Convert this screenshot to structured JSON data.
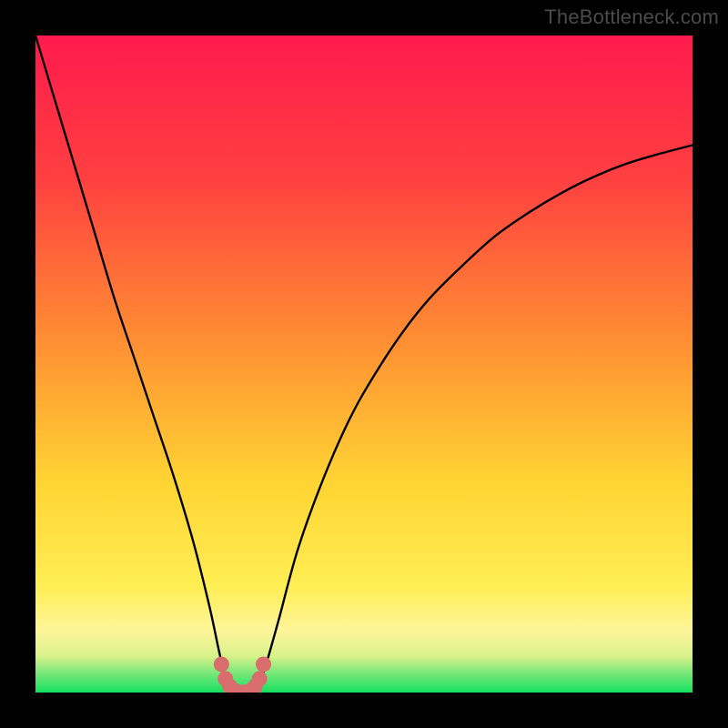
{
  "watermark": "TheBottleneck.com",
  "chart_data": {
    "type": "line",
    "title": "",
    "xlabel": "",
    "ylabel": "",
    "xlim": [
      0,
      100
    ],
    "ylim": [
      0,
      100
    ],
    "grid": false,
    "legend": false,
    "notes": "V-shaped bottleneck curve on a red→yellow→green vertical gradient background. Y represents bottleneck severity (0 = no bottleneck / green at bottom, 100 = severe / red at top). Minimum (~0) occurs around x≈29–34 and is highlighted with salmon dots.",
    "series": [
      {
        "name": "bottleneck-curve",
        "x": [
          0,
          3,
          6,
          9,
          12,
          15,
          18,
          21,
          24,
          26.5,
          28,
          29,
          30,
          31,
          32,
          33,
          34,
          35,
          37,
          40,
          44,
          48,
          52,
          56,
          60,
          65,
          70,
          75,
          80,
          85,
          90,
          95,
          100
        ],
        "y": [
          100,
          90,
          80,
          70,
          60,
          51,
          42,
          33,
          23,
          13,
          6,
          2,
          0.5,
          0,
          0,
          0.5,
          1.5,
          4,
          11,
          22,
          33,
          42,
          49,
          55,
          60,
          65,
          69.5,
          73,
          76,
          78.5,
          80.5,
          82,
          83.3
        ]
      }
    ],
    "highlight_points": {
      "name": "minimum-region-dots",
      "color": "#d96d6d",
      "x": [
        28.3,
        28.9,
        29.6,
        30.5,
        31.5,
        32.5,
        33.4,
        34.1,
        34.7
      ],
      "y": [
        4.3,
        2.1,
        0.9,
        0.2,
        0,
        0.2,
        0.9,
        2.1,
        4.3
      ]
    },
    "background_gradient": {
      "top": "#ff1a4d",
      "mid_upper": "#ff8a33",
      "mid": "#ffd433",
      "mid_lower": "#fff59a",
      "bottom": "#14e060"
    }
  }
}
